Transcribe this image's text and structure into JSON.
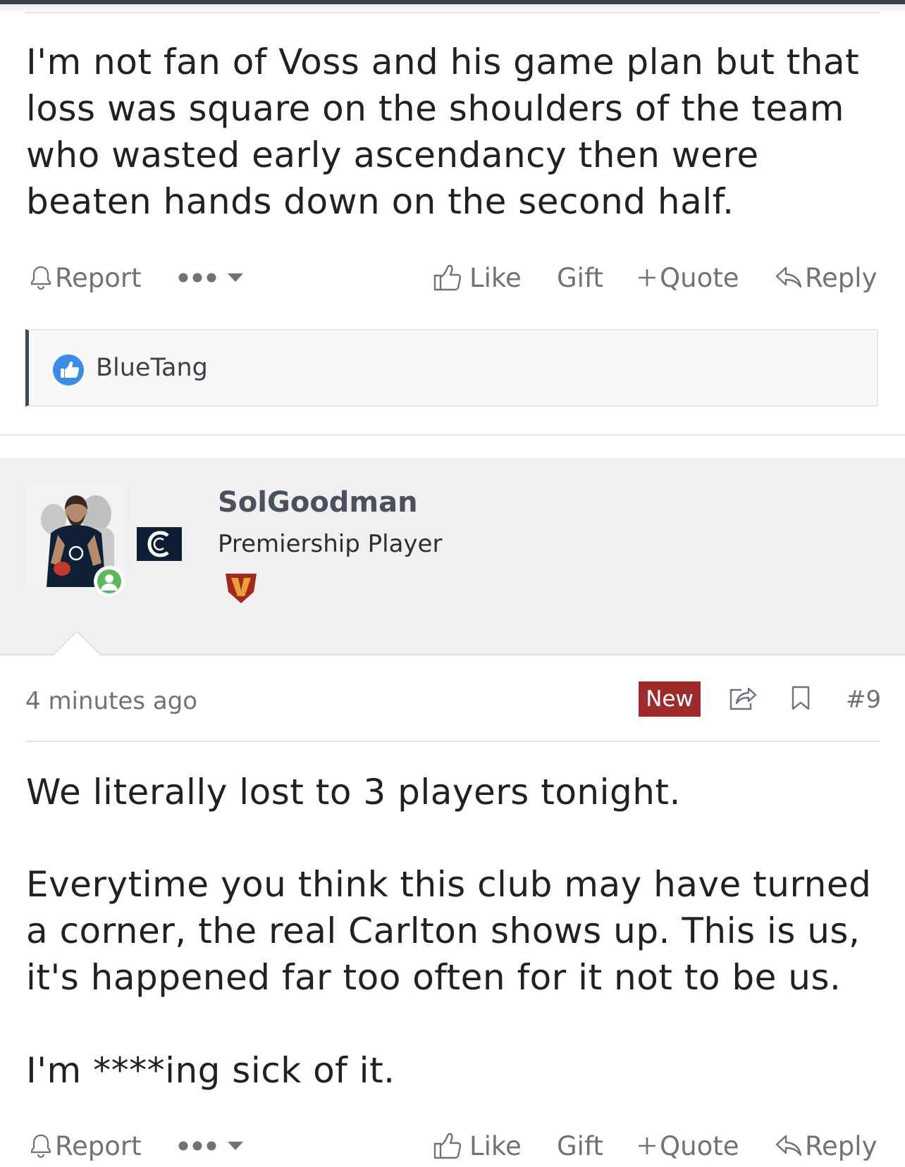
{
  "post1": {
    "body": "I'm not fan of Voss and his game plan but that loss was square on the shoulders of the team who wasted early ascendancy then were beaten hands down on the second half.",
    "actions": {
      "report": "Report",
      "like": "Like",
      "gift": "Gift",
      "quote": "Quote",
      "reply": "Reply"
    },
    "likes": {
      "users": "BlueTang"
    }
  },
  "post2": {
    "author": {
      "name": "SolGoodman",
      "title": "Premiership Player",
      "online": true,
      "badge_letter": "V"
    },
    "meta": {
      "time": "4 minutes ago",
      "new_label": "New",
      "post_number": "#9"
    },
    "body": {
      "p1": "We literally lost to 3 players tonight.",
      "p2": "Everytime you think this club may have turned a corner, the real Carlton shows up. This is us, it's happened far too often for it not to be us.",
      "p3": "I'm ****ing sick of it."
    },
    "actions": {
      "report": "Report",
      "like": "Like",
      "gift": "Gift",
      "quote": "Quote",
      "reply": "Reply"
    }
  },
  "colors": {
    "new_badge": "#9e2b2b",
    "online": "#5cb85c",
    "like_icon": "#3a8ce6",
    "username": "#4a505c",
    "muted": "#6f727b"
  },
  "icons": [
    "bell-icon",
    "more-dots-icon",
    "chevron-down-icon",
    "thumbs-up-icon",
    "plus-icon",
    "reply-arrow-icon",
    "like-reaction-icon",
    "user-online-icon",
    "share-icon",
    "bookmark-icon"
  ]
}
